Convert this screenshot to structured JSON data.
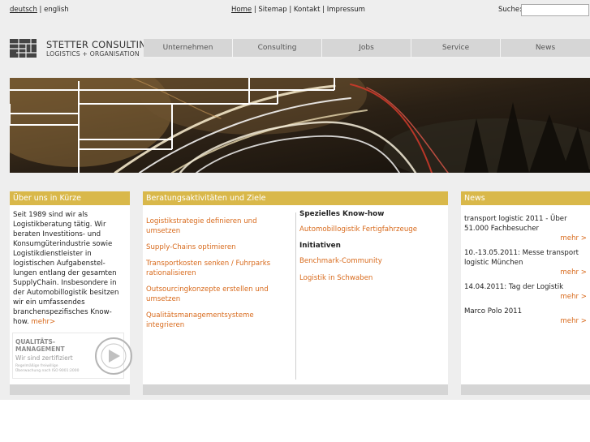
{
  "lang": {
    "de": "deutsch",
    "sep": "|",
    "en": "english"
  },
  "topnav": {
    "home": "Home",
    "sitemap": "Sitemap",
    "kontakt": "Kontakt",
    "impressum": "Impressum",
    "sep": "|"
  },
  "search": {
    "label": "Suche:",
    "value": "",
    "placeholder": ""
  },
  "logo": {
    "title": "STETTER CONSULTING",
    "subtitle": "LOGISTICS + ORGANISATION"
  },
  "mainnav": [
    {
      "label": "Unternehmen"
    },
    {
      "label": "Consulting"
    },
    {
      "label": "Jobs"
    },
    {
      "label": "Service"
    },
    {
      "label": "News"
    }
  ],
  "about": {
    "header": "Über uns in Kürze",
    "text": "Seit 1989 sind wir als Logistikberatung tätig. Wir beraten Investitions- und Konsumgüterindustrie sowie Logistikdienstleister in logistischen Aufgabenstel­lungen entlang der gesamten SupplyChain. Insbesondere in der Automobillogistik besitzen wir ein umfassendes branchenspezifisches Know-how.",
    "more": "mehr>",
    "cert": {
      "line1": "QUALITÄTS-",
      "line2": "MANAGEMENT",
      "line3": "Wir sind zertifiziert",
      "line4": "Regelmäßige freiwillige",
      "line5": "Überwachung nach ISO 9001:2000"
    }
  },
  "beratung": {
    "header": "Beratungsaktivitäten und Ziele",
    "items": [
      {
        "label": "Logistikstrategie definieren und umsetzen"
      },
      {
        "label": "Supply-Chains optimieren"
      },
      {
        "label": "Transportkosten senken / Fuhrparks rationalisieren"
      },
      {
        "label": "Outsourcingkonzepte erstellen und umsetzen"
      },
      {
        "label": "Qualitätsmanagementsysteme integrieren"
      }
    ],
    "knowhow_title": "Spezielles Know-how",
    "knowhow_link": "Automobillogistik Fertigfahrzeuge",
    "initiativen_title": "Initiativen",
    "initiativen": [
      {
        "label": "Benchmark-Community"
      },
      {
        "label": "Logistik in Schwaben"
      }
    ]
  },
  "news": {
    "header": "News",
    "items": [
      {
        "text": "transport logistic 2011 - Über 51.000 Fachbesucher",
        "more": "mehr >"
      },
      {
        "text": "10.-13.05.2011: Messe transport logistic München",
        "more": "mehr >"
      },
      {
        "text": "14.04.2011: Tag der Logistik",
        "more": "mehr >"
      },
      {
        "text": "Marco Polo 2011",
        "more": "mehr >"
      }
    ]
  },
  "colors": {
    "accent": "#d9b84a",
    "link": "#d86a1c",
    "nav_bg": "#d6d6d6",
    "page_bg": "#eeeeee"
  }
}
